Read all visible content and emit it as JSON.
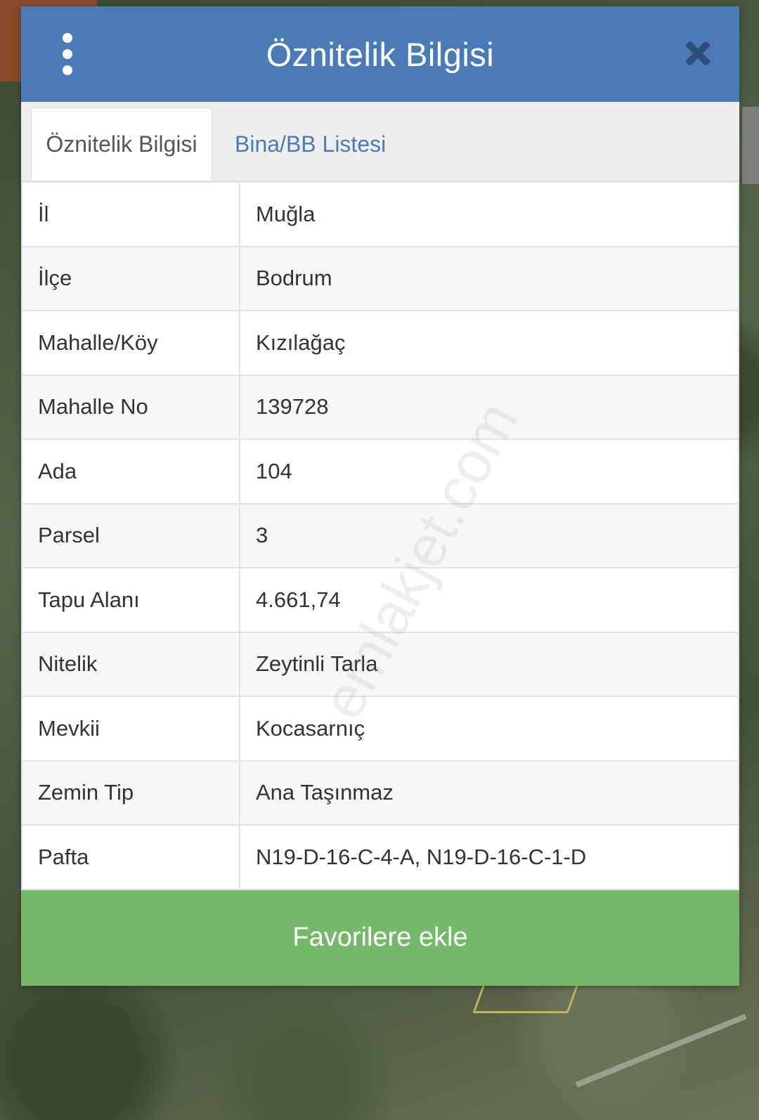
{
  "dialog": {
    "title": "Öznitelik Bilgisi",
    "tabs": [
      {
        "label": "Öznitelik Bilgisi",
        "active": true
      },
      {
        "label": "Bina/BB Listesi",
        "active": false
      }
    ],
    "rows": [
      {
        "key": "İl",
        "value": "Muğla"
      },
      {
        "key": "İlçe",
        "value": "Bodrum"
      },
      {
        "key": "Mahalle/Köy",
        "value": "Kızılağaç"
      },
      {
        "key": "Mahalle No",
        "value": "139728"
      },
      {
        "key": "Ada",
        "value": "104"
      },
      {
        "key": "Parsel",
        "value": "3"
      },
      {
        "key": "Tapu Alanı",
        "value": "4.661,74"
      },
      {
        "key": "Nitelik",
        "value": "Zeytinli Tarla"
      },
      {
        "key": "Mevkii",
        "value": "Kocasarnıç"
      },
      {
        "key": "Zemin Tip",
        "value": "Ana Taşınmaz"
      },
      {
        "key": "Pafta",
        "value": "N19-D-16-C-4-A, N19-D-16-C-1-D"
      }
    ],
    "favorite_button_label": "Favorilere ekle"
  },
  "watermark": "emlakjet.com",
  "icons": {
    "menu": "more-vertical-icon",
    "close": "close-icon"
  },
  "colors": {
    "header": "#4a7bb7",
    "favorite_button": "#74b86a",
    "tab_link": "#4a7bb7"
  }
}
